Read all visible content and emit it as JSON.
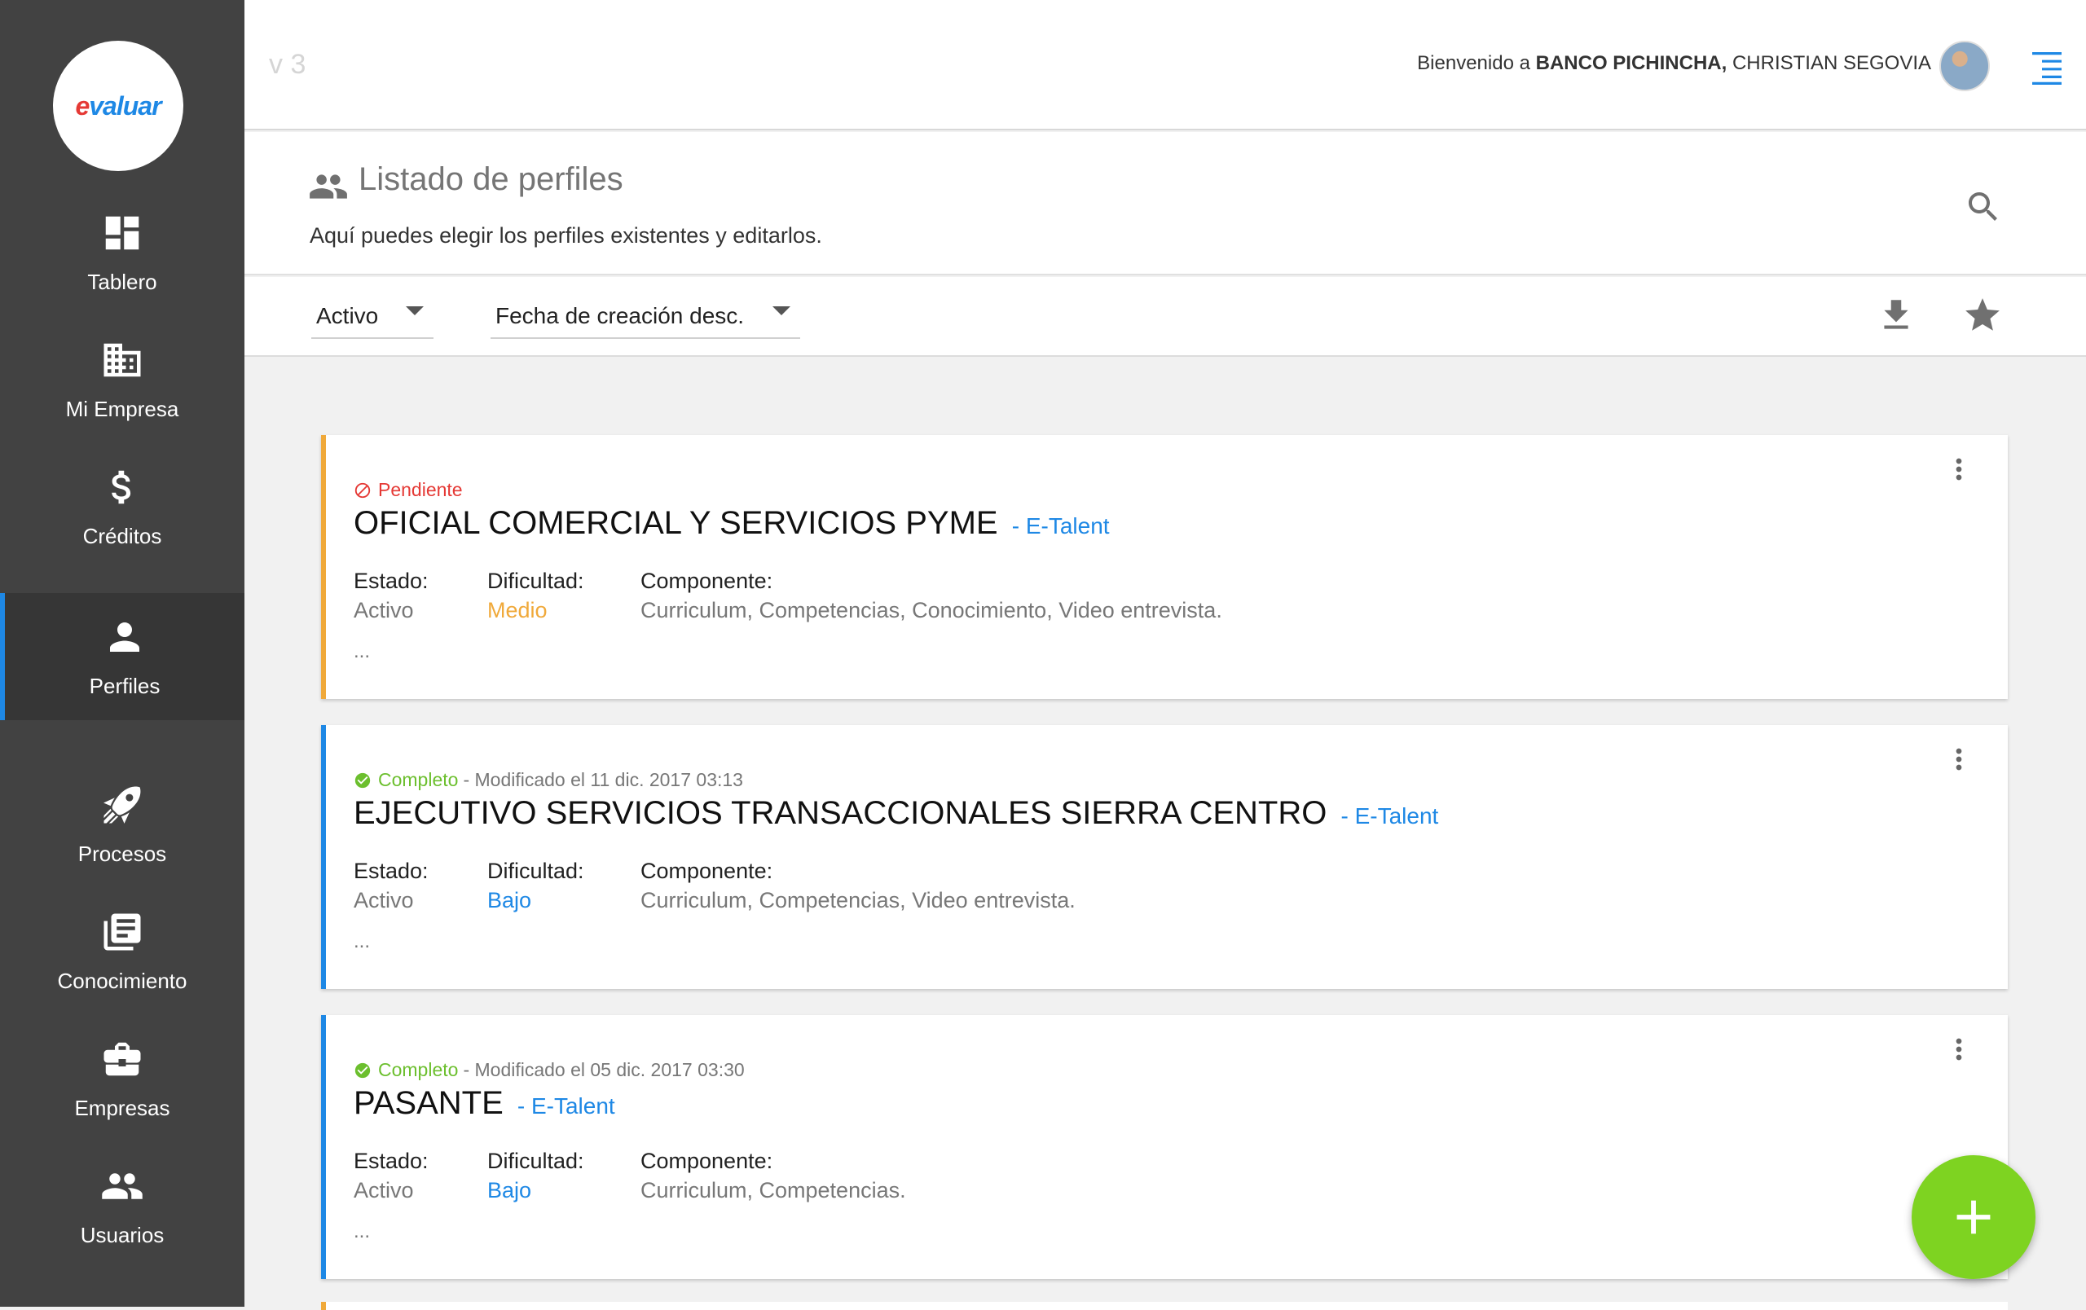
{
  "app": {
    "logo_text_e": "e",
    "logo_text_rest": "valuar",
    "version": "v 3"
  },
  "sidebar": {
    "items": [
      {
        "label": "Tablero",
        "icon": "dashboard-icon"
      },
      {
        "label": "Mi Empresa",
        "icon": "building-icon"
      },
      {
        "label": "Créditos",
        "icon": "dollar-icon"
      },
      {
        "label": "Perfiles",
        "icon": "person-icon",
        "active": true
      },
      {
        "label": "Procesos",
        "icon": "rocket-icon"
      },
      {
        "label": "Conocimiento",
        "icon": "library-books-icon"
      },
      {
        "label": "Empresas",
        "icon": "briefcase-icon"
      },
      {
        "label": "Usuarios",
        "icon": "people-icon"
      }
    ]
  },
  "header": {
    "welcome_prefix": "Bienvenido a",
    "company": "BANCO PICHINCHA,",
    "user": "CHRISTIAN SEGOVIA"
  },
  "page": {
    "title": "Listado de perfiles",
    "subtitle": "Aquí puedes elegir los perfiles existentes y editarlos."
  },
  "filters": {
    "status_value": "Activo",
    "order_value": "Fecha de creación desc."
  },
  "labels": {
    "estado": "Estado:",
    "dificultad": "Dificultad:",
    "componente": "Componente:",
    "ellipsis": "..."
  },
  "cards": [
    {
      "status": "Pendiente",
      "modified": "",
      "title": "OFICIAL COMERCIAL Y SERVICIOS PYME",
      "source": "- E-Talent",
      "estado": "Activo",
      "dificultad": "Medio",
      "componente": "Curriculum, Competencias, Conocimiento, Video entrevista."
    },
    {
      "status": "Completo",
      "modified": "- Modificado el 11 dic. 2017 03:13",
      "title": "EJECUTIVO SERVICIOS TRANSACCIONALES SIERRA CENTRO",
      "source": "- E-Talent",
      "estado": "Activo",
      "dificultad": "Bajo",
      "componente": "Curriculum, Competencias, Video entrevista."
    },
    {
      "status": "Completo",
      "modified": "- Modificado el 05 dic. 2017 03:30",
      "title": "PASANTE",
      "source": "- E-Talent",
      "estado": "Activo",
      "dificultad": "Bajo",
      "componente": "Curriculum, Competencias."
    }
  ],
  "colors": {
    "sidebar_bg": "#424242",
    "accent_blue": "#1e88e5",
    "pending_red": "#e53935",
    "medium_orange": "#f0a93a",
    "complete_green": "#6cbf2e",
    "fab_green": "#7ed321"
  }
}
